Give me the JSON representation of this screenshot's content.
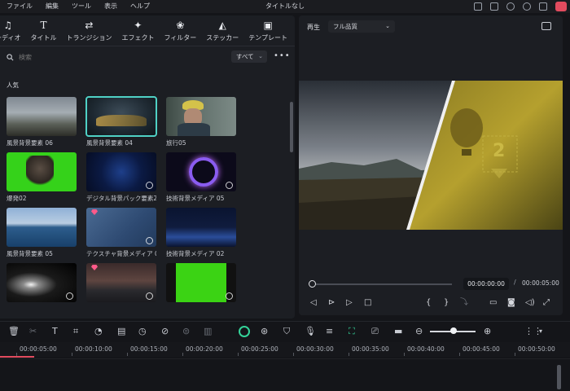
{
  "menu": [
    "ファイル",
    "編集",
    "ツール",
    "表示",
    "ヘルプ"
  ],
  "app_title": "タイトルなし",
  "tabs": [
    {
      "label": "ーディオ",
      "icon": "music-note-icon"
    },
    {
      "label": "タイトル",
      "icon": "title-text-icon"
    },
    {
      "label": "トランジション",
      "icon": "transition-icon"
    },
    {
      "label": "エフェクト",
      "icon": "effects-sparkle-icon"
    },
    {
      "label": "フィルター",
      "icon": "filter-icon"
    },
    {
      "label": "ステッカー",
      "icon": "sticker-icon"
    },
    {
      "label": "テンプレート",
      "icon": "template-icon"
    }
  ],
  "search": {
    "placeholder": "検索",
    "filter": "すべて"
  },
  "category": "人気",
  "assets": [
    {
      "label": "風景背景要素 06"
    },
    {
      "label": "風景背景要素 04",
      "selected": true
    },
    {
      "label": "旅行05"
    },
    {
      "label": "爆発02"
    },
    {
      "label": "デジタル背景パック要素24"
    },
    {
      "label": "技術背景メディア 05"
    },
    {
      "label": "風景背景要素 05"
    },
    {
      "label": "テクスチャ背景メディア 03",
      "premium": true
    },
    {
      "label": "技術背景メディア 02"
    },
    {
      "label": ""
    },
    {
      "label": "",
      "premium": true
    },
    {
      "label": ""
    }
  ],
  "player": {
    "label": "再生",
    "quality": "フル品質",
    "current_time": "00:00:00:00",
    "separator": "/",
    "total_time": "00:00:05:00",
    "progress": 0.0,
    "overlay_number": "2"
  },
  "ruler_ticks": [
    "00:00:05:00",
    "00:00:10:00",
    "00:00:15:00",
    "00:00:20:00",
    "00:00:25:00",
    "00:00:30:00",
    "00:00:35:00",
    "00:00:40:00",
    "00:00:45:00",
    "00:00:50:00"
  ],
  "colors": {
    "accent": "#4fd1c5",
    "playhead": "#e24b5e",
    "record": "#34d399"
  }
}
